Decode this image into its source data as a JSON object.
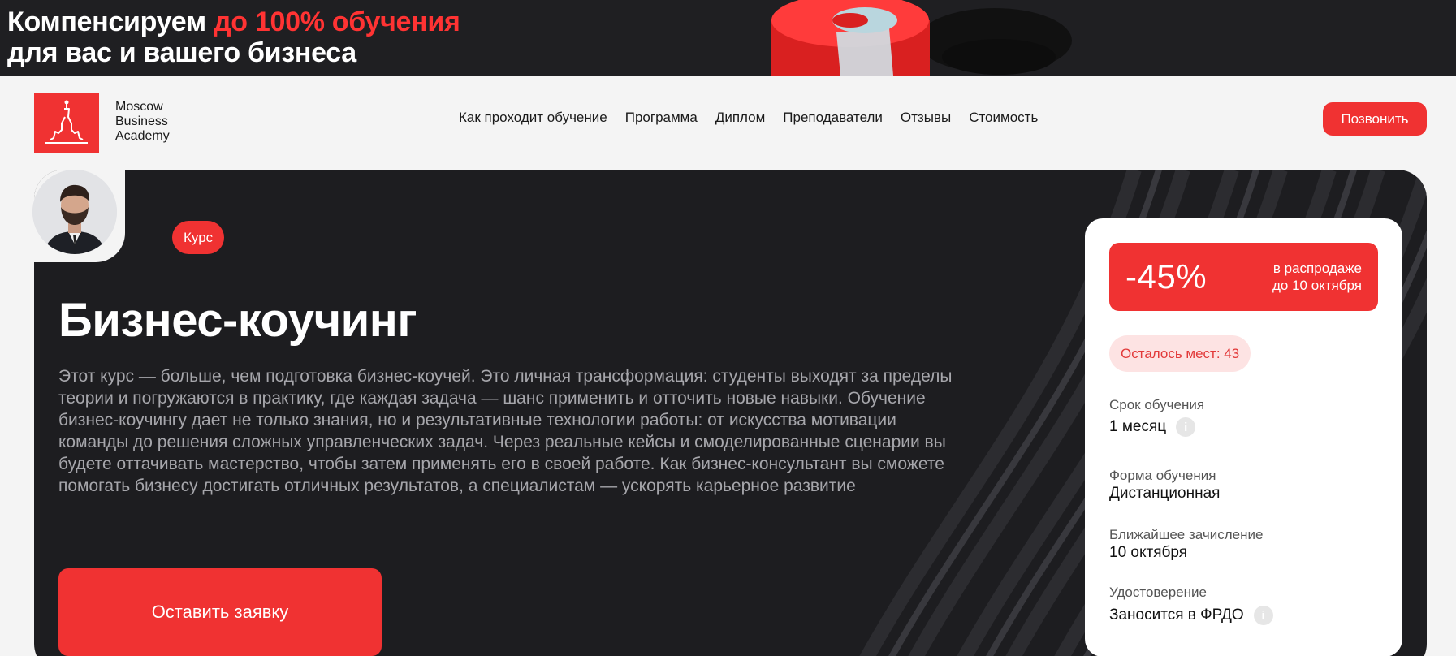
{
  "promo": {
    "line1_plain": "Компенсируем ",
    "line1_accent": "до 100% обучения",
    "line2": "для вас и вашего бизнеса"
  },
  "header": {
    "logo_line1": "Moscow",
    "logo_line2": "Business",
    "logo_line3": "Academy",
    "nav": [
      "Как проходит обучение",
      "Программа",
      "Диплом",
      "Преподаватели",
      "Отзывы",
      "Стоимость"
    ],
    "call_label": "Позвонить"
  },
  "hero": {
    "tag": "Курс",
    "title": "Бизнес-коучинг",
    "description": "Этот курс — больше, чем подготовка бизнес-коучей. Это личная трансформация: студенты выходят за пределы теории и погружаются в практику, где каждая задача — шанс применить и отточить новые навыки. Обучение бизнес-коучингу дает не только знания, но и результативные технологии работы: от искусства мотивации команды до решения сложных управленческих задач. Через реальные кейсы и смоделированные сценарии вы будете оттачивать мастерство, чтобы затем применять его в своей работе. Как бизнес-консультант вы сможете помогать бизнесу достигать отличных результатов, а специалистам — ускорять карьерное развитие",
    "apply_label": "Оставить заявку"
  },
  "card": {
    "discount": "-45%",
    "discount_note_1": "в распродаже",
    "discount_note_2": "до 10 октября",
    "seats": "Осталось мест: 43",
    "items": [
      {
        "label": "Срок обучения",
        "value": "1 месяц"
      },
      {
        "label": "Форма обучения",
        "value": "Дистанционная"
      },
      {
        "label": "Ближайшее зачисление",
        "value": "10 октября"
      },
      {
        "label": "Удостоверение",
        "value": "Заносится в ФРДО"
      }
    ]
  },
  "colors": {
    "accent": "#f03232",
    "dark": "#1d1d20",
    "background": "#f4f4f4"
  }
}
